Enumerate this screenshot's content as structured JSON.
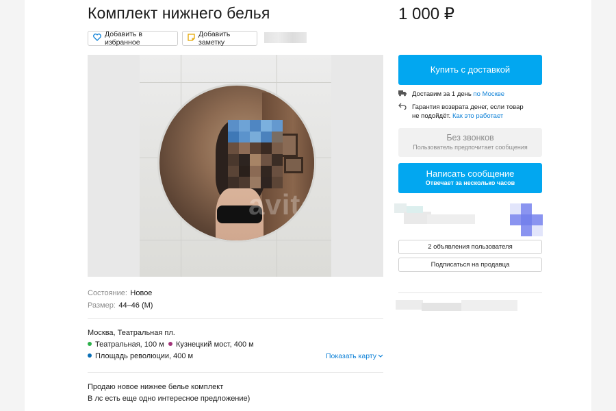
{
  "listing": {
    "title": "Комплект нижнего белья",
    "price": "1 000 ₽",
    "favorite_label": "Добавить в избранное",
    "note_label": "Добавить заметку",
    "photo_watermark": "avito",
    "specs": [
      {
        "label": "Состояние:",
        "value": "Новое"
      },
      {
        "label": "Размер:",
        "value": "44–46 (M)"
      }
    ],
    "address": "Москва, Театральная пл.",
    "metro": [
      {
        "name": "Театральная, 100 м",
        "color": "#2db04b"
      },
      {
        "name": "Кузнецкий мост, 400 м",
        "color": "#a2357a"
      },
      {
        "name": "Площадь революции, 400 м",
        "color": "#0a6fb6"
      }
    ],
    "show_map_label": "Показать карту",
    "description": [
      "Продаю новое нижнее белье комплект",
      "В лс есть еще одно интересное предложение)"
    ]
  },
  "sidebar": {
    "buy_delivery_label": "Купить с доставкой",
    "delivery_text": "Доставим за 1 день",
    "delivery_link": "по Москве",
    "guarantee_text_1": "Гарантия возврата денег, если товар",
    "guarantee_text_2": "не подойдёт.",
    "guarantee_link": "Как это работает",
    "no_calls_title": "Без звонков",
    "no_calls_sub": "Пользователь предпочитает сообщения",
    "message_title": "Написать сообщение",
    "message_sub": "Отвечает за несколько часов",
    "user_ads_label": "2 объявления пользователя",
    "subscribe_label": "Подписаться на продавца"
  },
  "colors": {
    "accent": "#02a7f0",
    "link": "#0a7fd6"
  },
  "icons": {
    "favorite": "heart-icon",
    "note": "note-icon",
    "delivery": "truck-icon",
    "guarantee": "return-arrow-icon",
    "map_chevron": "chevron-down-icon"
  }
}
